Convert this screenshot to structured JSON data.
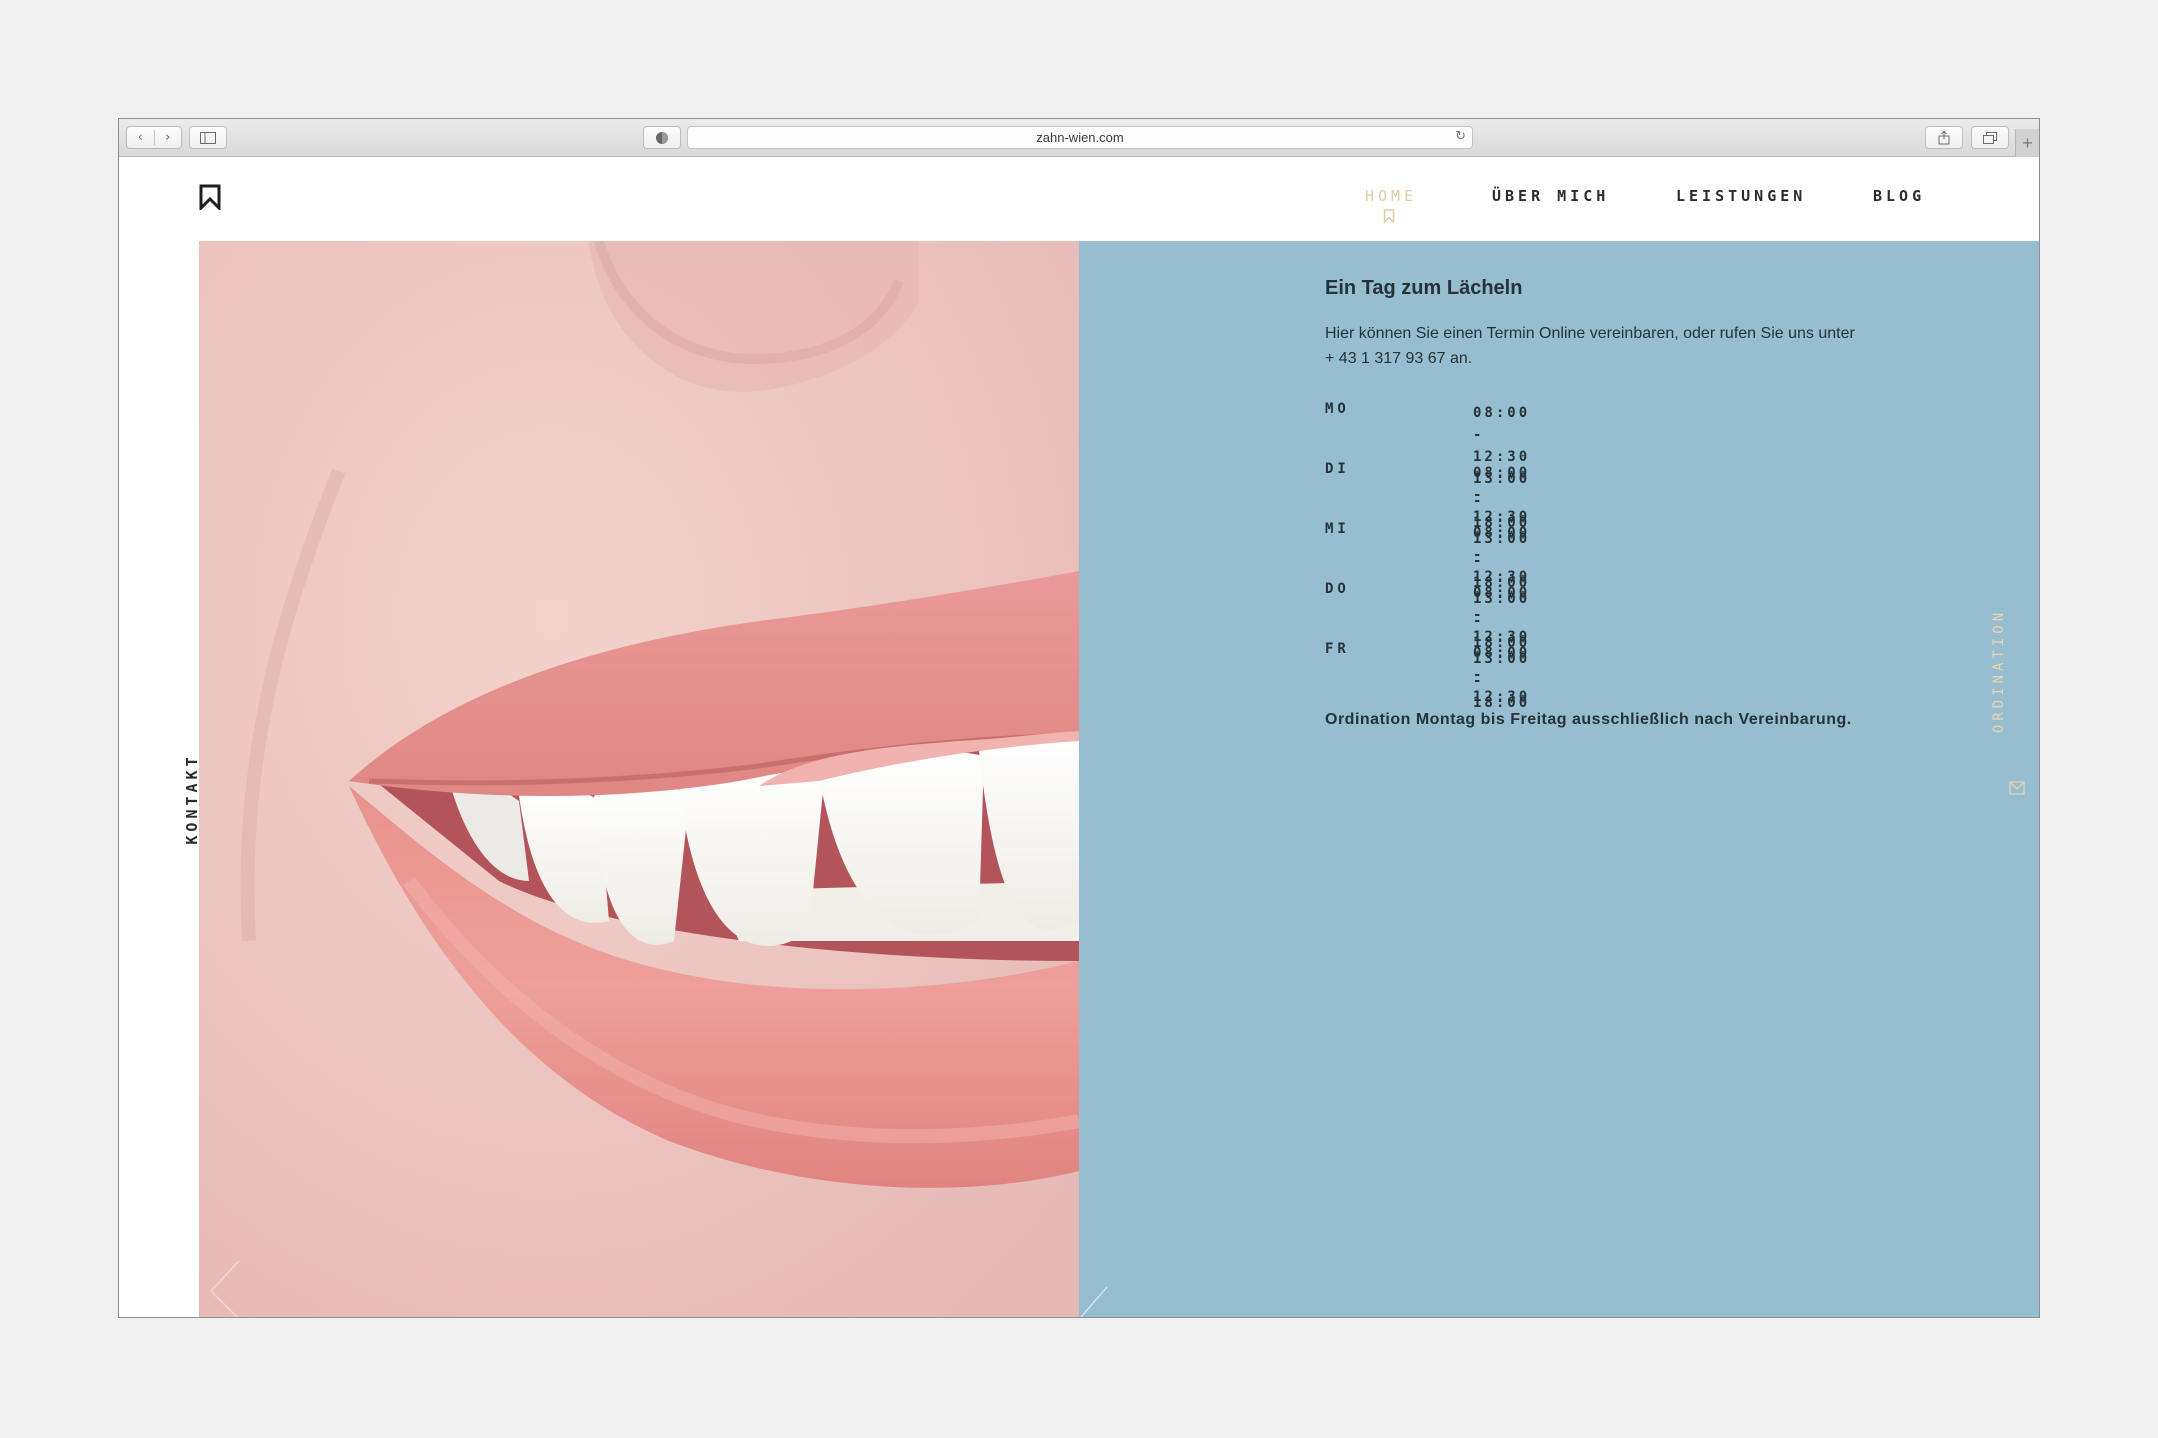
{
  "browser": {
    "url": "zahn-wien.com",
    "back_icon": "chevron-left-icon",
    "forward_icon": "chevron-right-icon",
    "reload_icon": "reload-icon",
    "plus_label": "+"
  },
  "nav": {
    "items": [
      {
        "label": "HOME",
        "active": true
      },
      {
        "label": "ÜBER MICH",
        "active": false
      },
      {
        "label": "LEISTUNGEN",
        "active": false
      },
      {
        "label": "BLOG",
        "active": false
      }
    ]
  },
  "side": {
    "contact_label": "KONTAKT",
    "ordination_label": "ORDINATION"
  },
  "info": {
    "title": "Ein Tag zum Lächeln",
    "intro_line1": "Hier können Sie einen Termin Online vereinbaren, oder rufen Sie uns unter",
    "intro_line2": "+ 43 1 317 93 67 an.",
    "hours": [
      {
        "day": "MO",
        "times": [
          "08:00 - 12:30",
          "13:00 - 18:00"
        ]
      },
      {
        "day": "DI",
        "times": [
          "08:00 - 12:30",
          "13:00 - 18:00"
        ]
      },
      {
        "day": "MI",
        "times": [
          "08:00 - 12:30",
          "13:00 - 18:00"
        ]
      },
      {
        "day": "DO",
        "times": [
          "08:00 - 12:30",
          "13:00 - 18:00"
        ]
      },
      {
        "day": "FR",
        "times": [
          "08:00 - 12:30"
        ]
      }
    ],
    "note": "Ordination Montag bis Freitag ausschließlich nach Vereinbarung."
  },
  "colors": {
    "panel": "#96bdd0",
    "accent": "#e2cba6",
    "text": "#263238"
  }
}
